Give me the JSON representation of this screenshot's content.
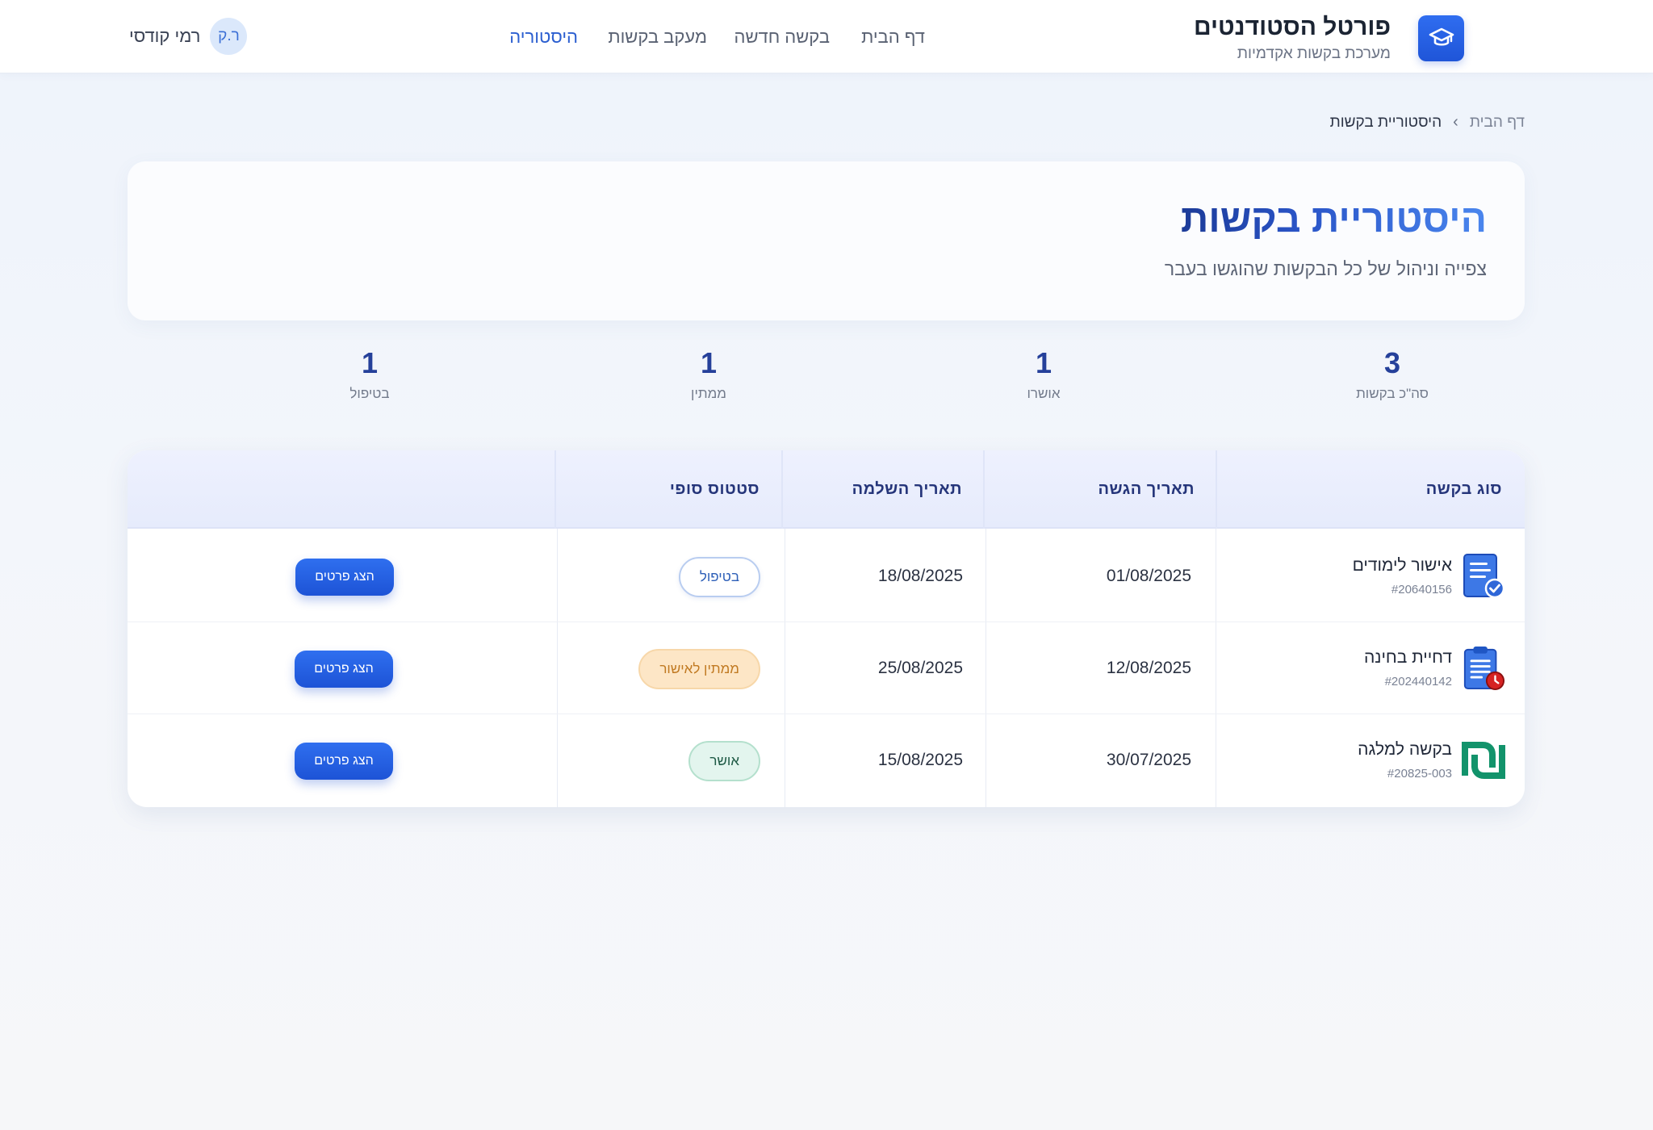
{
  "header": {
    "brand_title": "פורטל הסטודנטים",
    "brand_subtitle": "מערכת בקשות אקדמיות",
    "brand_icon": "graduation-cap-icon",
    "nav": [
      {
        "label": "דף הבית",
        "active": false
      },
      {
        "label": "בקשה חדשה",
        "active": false
      },
      {
        "label": "מעקב בקשות",
        "active": false
      },
      {
        "label": "היסטוריה",
        "active": true
      }
    ],
    "user": {
      "initials": "ר.ק",
      "name": "רמי קודסי"
    }
  },
  "breadcrumb": {
    "home": "דף הבית",
    "separator": "›",
    "current": "היסטוריית בקשות"
  },
  "hero": {
    "title": "היסטוריית בקשות",
    "subtitle": "צפייה וניהול של כל הבקשות שהוגשו בעבר"
  },
  "stats": [
    {
      "value": "3",
      "label": "סה\"כ בקשות"
    },
    {
      "value": "1",
      "label": "אושרו"
    },
    {
      "value": "1",
      "label": "ממתין"
    },
    {
      "value": "1",
      "label": "בטיפול"
    }
  ],
  "table": {
    "columns": [
      "סוג בקשה",
      "תאריך הגשה",
      "תאריך השלמה",
      "סטטוס סופי",
      ""
    ],
    "rows": [
      {
        "type": "אישור לימודים",
        "id": "#20640156",
        "icon": "certificate-icon",
        "submitted": "01/08/2025",
        "completed": "18/08/2025",
        "status": "בטיפול",
        "status_kind": "processing",
        "action": "הצג פרטים"
      },
      {
        "type": "דחיית בחינה",
        "id": "#202440142",
        "icon": "clipboard-clock-icon",
        "submitted": "12/08/2025",
        "completed": "25/08/2025",
        "status": "ממתין לאישור",
        "status_kind": "pending",
        "action": "הצג פרטים"
      },
      {
        "type": "בקשה למלגה",
        "id": "#20825-003",
        "icon": "shekel-icon",
        "submitted": "30/07/2025",
        "completed": "15/08/2025",
        "status": "אושר",
        "status_kind": "approved",
        "action": "הצג פרטים"
      }
    ]
  },
  "colors": {
    "accent": "#1f55d8",
    "title": "#2a55c8",
    "pending": "#c17a22",
    "approved": "#1e5a45",
    "shekel": "#12936b"
  }
}
